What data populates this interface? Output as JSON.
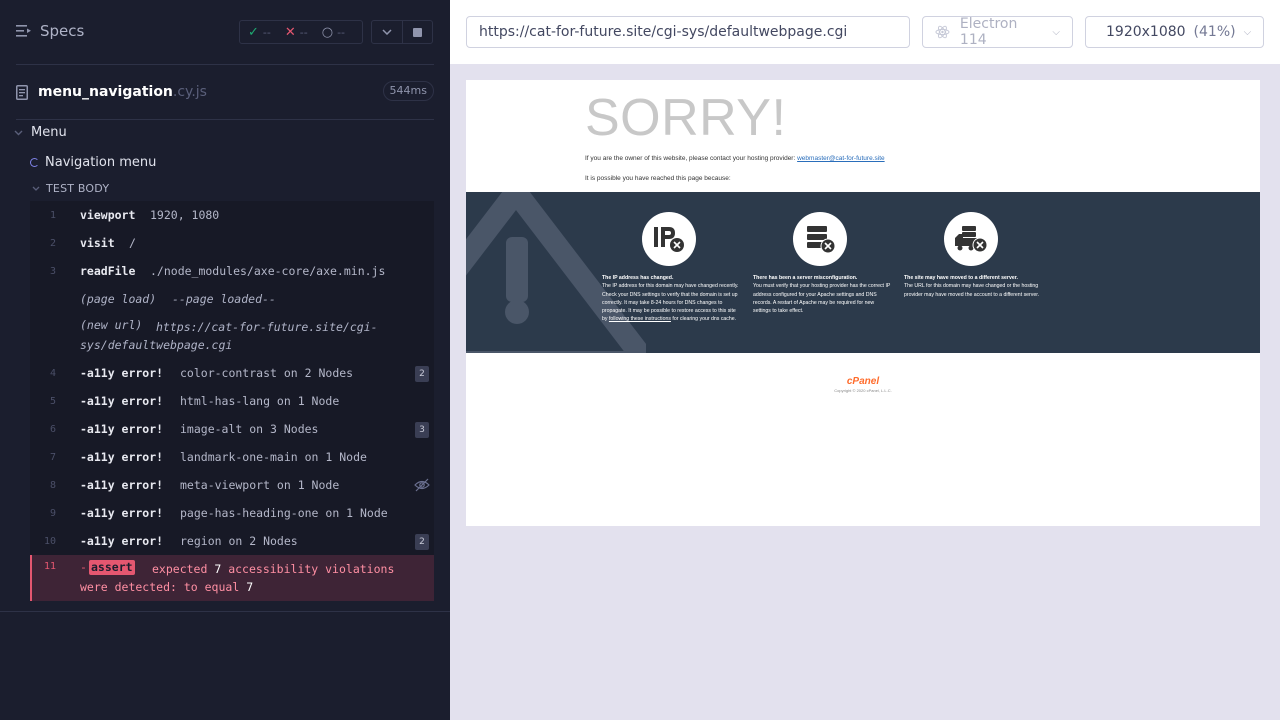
{
  "runner": {
    "specs_label": "Specs",
    "stats": {
      "passed": "--",
      "failed": "--",
      "pending": "--"
    },
    "file": {
      "name": "menu_navigation",
      "ext": ".cy.js",
      "duration": "544ms"
    },
    "suite": "Menu",
    "test": "Navigation menu",
    "body_label": "TEST BODY",
    "commands": [
      {
        "num": "1",
        "name": "viewport",
        "msg": "1920, 1080"
      },
      {
        "num": "2",
        "name": "visit",
        "msg": "/"
      },
      {
        "num": "3",
        "name": "readFile",
        "msg": "./node_modules/axe-core/axe.min.js"
      },
      {
        "num": "",
        "name": "(page load)",
        "msg": "--page loaded--"
      },
      {
        "num": "",
        "name": "(new url)",
        "msg": "https://cat-for-future.site/cgi-sys/defaultwebpage.cgi"
      },
      {
        "num": "4",
        "name": "-a11y error!",
        "msg": "color-contrast on 2 Nodes",
        "badge": "2"
      },
      {
        "num": "5",
        "name": "-a11y error!",
        "msg": "html-has-lang on 1 Node"
      },
      {
        "num": "6",
        "name": "-a11y error!",
        "msg": "image-alt on 3 Nodes",
        "badge": "3"
      },
      {
        "num": "7",
        "name": "-a11y error!",
        "msg": "landmark-one-main on 1 Node"
      },
      {
        "num": "8",
        "name": "-a11y error!",
        "msg": "meta-viewport on 1 Node"
      },
      {
        "num": "9",
        "name": "-a11y error!",
        "msg": "page-has-heading-one on 1 Node"
      },
      {
        "num": "10",
        "name": "-a11y error!",
        "msg": "region on 2 Nodes",
        "badge": "2"
      }
    ],
    "assert": {
      "num": "11",
      "dash": "-",
      "tag": "assert",
      "msg_start": "expected",
      "value1": "7",
      "msg_mid": "accessibility violations were detected: to equal",
      "value2": "7"
    }
  },
  "preview": {
    "url": "https://cat-for-future.site/cgi-sys/defaultwebpage.cgi",
    "browser": "Electron 114",
    "viewport": "1920x1080",
    "scale": "(41%)",
    "page": {
      "title": "SORRY!",
      "owner_text": "If you are the owner of this website, please contact your hosting provider:",
      "owner_email": "webmaster@cat-for-future.site",
      "reached_text": "It is possible you have reached this page because:",
      "reasons": [
        {
          "title": "The IP address has changed.",
          "text": "The IP address for this domain may have changed recently. Check your DNS settings to verify that the domain is set up correctly. It may take 8-24 hours for DNS changes to propagate. It may be possible to restore access to this site by",
          "link": "following these instructions",
          "tail": "for clearing your dns cache."
        },
        {
          "title": "There has been a server misconfiguration.",
          "text": "You must verify that your hosting provider has the correct IP address configured for your Apache settings and DNS records. A restart of Apache may be required for new settings to take effect."
        },
        {
          "title": "The site may have moved to a different server.",
          "text": "The URL for this domain may have changed or the hosting provider may have moved the account to a different server."
        }
      ],
      "cpanel_logo": "cPanel",
      "copyright": "Copyright © 2020 cPanel, L.L.C."
    }
  }
}
